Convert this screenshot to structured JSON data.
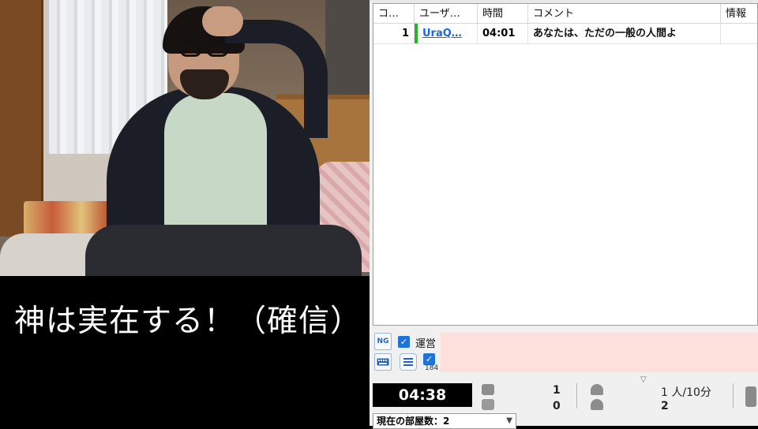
{
  "caption": {
    "text": "神は実在する！（確信）"
  },
  "grid": {
    "headers": [
      "コ…",
      "ユーザ…",
      "時間",
      "コメント",
      "情報"
    ],
    "rows": [
      {
        "num": "1",
        "user": "UraQ…",
        "time": "04:01",
        "comment": "あなたは、ただの一般の人間よ",
        "info": ""
      }
    ]
  },
  "post": {
    "ng_label": "NG",
    "unei_label": "運営",
    "count_184": "184",
    "comment_placeholder": ""
  },
  "status": {
    "clock": "04:38",
    "comments_top": "1",
    "comments_bottom": "0",
    "viewers_top": "1 人/10分",
    "viewers_bottom": "2",
    "room": "現在の部屋数：2"
  },
  "icons": {
    "ng": "ng-filter-icon",
    "keyboard": "keyboard-icon",
    "list": "list-icon",
    "comment": "comment-bubble-icon",
    "user": "viewer-icon"
  },
  "colors": {
    "accent": "#1e73d8",
    "input_bg": "#fde0dc",
    "user_link": "#1a6ad6"
  }
}
